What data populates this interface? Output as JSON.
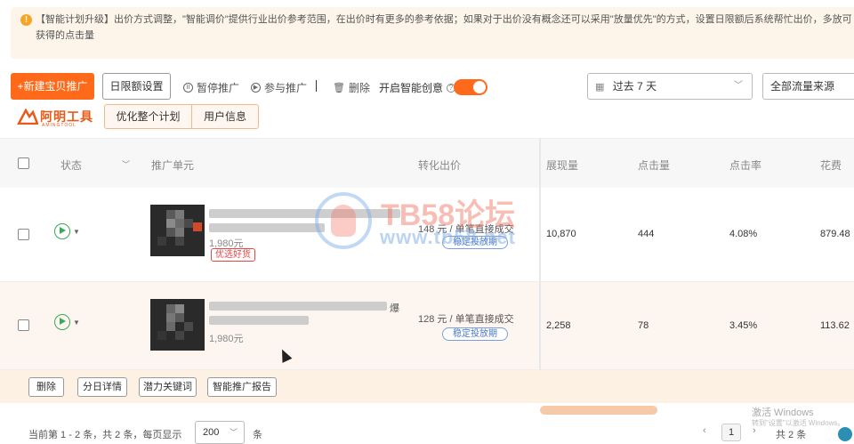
{
  "notice": {
    "text": "【智能计划升级】出价方式调整，\"智能调价\"提供行业出价参考范围，在出价时有更多的参考依据；如果对于出价没有概念还可以采用\"放量优先\"的方式，设置日限额后系统帮忙出价，多放可获得的点击量"
  },
  "toolbar": {
    "new_label": "+新建宝贝推广",
    "daily_limit_label": "日限额设置",
    "pause_label": "暂停推广",
    "join_label": "参与推广",
    "delete_label": "删除",
    "smart_creative_label": "开启智能创意",
    "time_select": "过去 7 天",
    "source_select": "全部流量来源"
  },
  "brand": {
    "name": "阿明工具",
    "sub": "AMINGTOOL"
  },
  "plugin": {
    "optimize_label": "优化整个计划",
    "userinfo_label": "用户信息"
  },
  "table": {
    "headers": {
      "status": "状态",
      "unit": "推广单元",
      "bid": "转化出价",
      "impressions": "展现量",
      "clicks": "点击量",
      "ctr": "点击率",
      "cost": "花费"
    },
    "rows": [
      {
        "price": "1,980元",
        "tag": "优选好货",
        "bid": "148 元 / 单笔直接成交",
        "bid_tag": "稳定投放期",
        "impressions": "10,870",
        "clicks": "444",
        "ctr": "4.08%",
        "cost": "879.48"
      },
      {
        "title_tail": "爆",
        "price": "1,980元",
        "bid": "128 元 / 单笔直接成交",
        "bid_tag": "稳定投放期",
        "impressions": "2,258",
        "clicks": "78",
        "ctr": "3.45%",
        "cost": "113.62"
      }
    ]
  },
  "batch": {
    "delete": "删除",
    "daily_detail": "分日详情",
    "keywords": "潜力关键词",
    "report": "智能推广报告"
  },
  "pagination": {
    "summary_prefix": "当前第 1 - 2 条，共 2 条，每页显示",
    "page_size": "200",
    "suffix": "条",
    "current_page": "1",
    "total": "共 2 条"
  },
  "watermark": {
    "big": "TB58论坛",
    "url": "www.tb58.net"
  },
  "os_overlay": {
    "line1": "激活 Windows",
    "line2": "转到\"设置\"以激活 Windows。"
  },
  "colors": {
    "accent": "#ff6a1a",
    "status_green": "#3aa85a",
    "tag_red": "#e64545",
    "tag_blue": "#4b77c4"
  }
}
